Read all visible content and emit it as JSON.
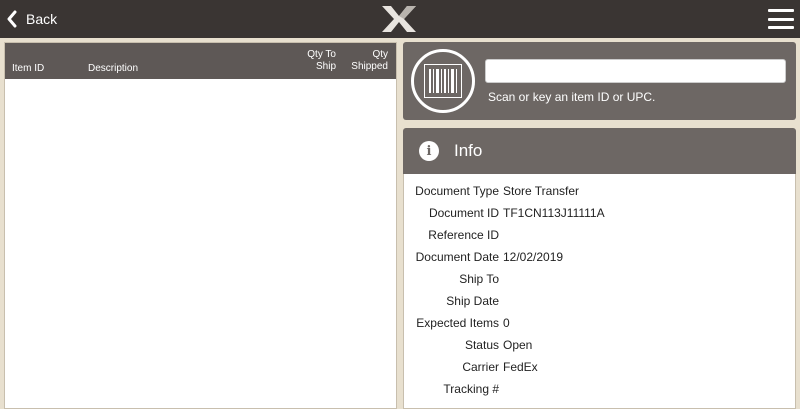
{
  "header": {
    "back_label": "Back",
    "logo_icon": "x-logo-icon",
    "menu_icon": "hamburger-menu-icon"
  },
  "table": {
    "columns": {
      "item_id": "Item ID",
      "description": "Description",
      "qty_to_ship": [
        "Qty To",
        "Ship"
      ],
      "qty_shipped": [
        "Qty",
        "Shipped"
      ]
    },
    "rows": []
  },
  "scan": {
    "icon": "barcode-icon",
    "input_value": "",
    "hint": "Scan or key an item ID or UPC."
  },
  "info": {
    "icon": "info-icon",
    "title": "Info",
    "rows": [
      {
        "label": "Document Type",
        "value": "Store Transfer"
      },
      {
        "label": "Document ID",
        "value": "TF1CN113J11111A"
      },
      {
        "label": "Reference ID",
        "value": ""
      },
      {
        "label": "Document Date",
        "value": "12/02/2019"
      },
      {
        "label": "Ship To",
        "value": ""
      },
      {
        "label": "Ship Date",
        "value": ""
      },
      {
        "label": "Expected Items",
        "value": "0"
      },
      {
        "label": "Status",
        "value": "Open"
      },
      {
        "label": "Carrier",
        "value": "FedEx"
      },
      {
        "label": "Tracking #",
        "value": ""
      }
    ]
  },
  "colors": {
    "topbar": "#3a3533",
    "panel_header": "#6d6764",
    "table_header": "#5e5856",
    "background": "#e8e0cf"
  }
}
